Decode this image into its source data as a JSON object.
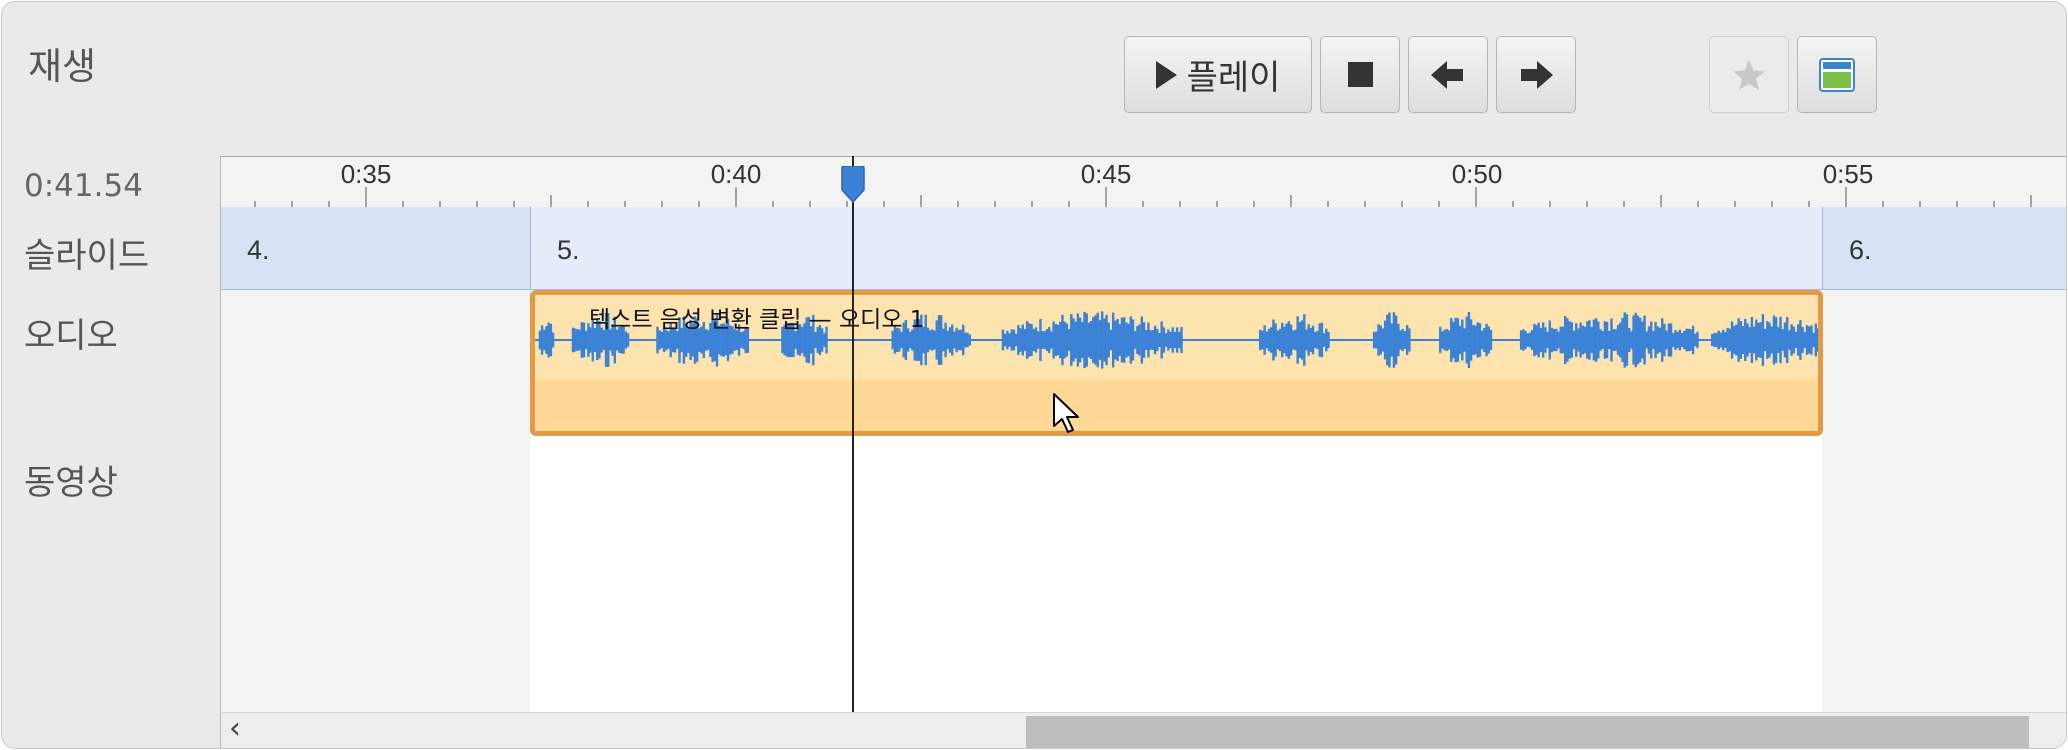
{
  "header": {
    "title": "재생",
    "play_label": "플레이"
  },
  "toolbar": {
    "buttons": [
      "play-button",
      "stop-button",
      "prev-button",
      "next-button",
      "favorite-button",
      "layout-button"
    ]
  },
  "time_display": "0:41.54",
  "rows": {
    "slides": "슬라이드",
    "audio": "오디오",
    "video": "동영상"
  },
  "ruler": {
    "labels": [
      "0:35",
      "0:40",
      "0:45",
      "0:50",
      "0:55"
    ]
  },
  "slides": [
    {
      "label": "4."
    },
    {
      "label": "5."
    },
    {
      "label": "6."
    }
  ],
  "audio_clip": {
    "title": "텍스트 음성 변환 클립 — 오디오 1"
  },
  "playhead_time_seconds": 41.54,
  "colors": {
    "accent": "#3b82d6",
    "clip_border": "#e39a45",
    "clip_fill": "#fde3ae",
    "slide_fill": "#d8e2f6",
    "waveform": "#3b82d6"
  }
}
